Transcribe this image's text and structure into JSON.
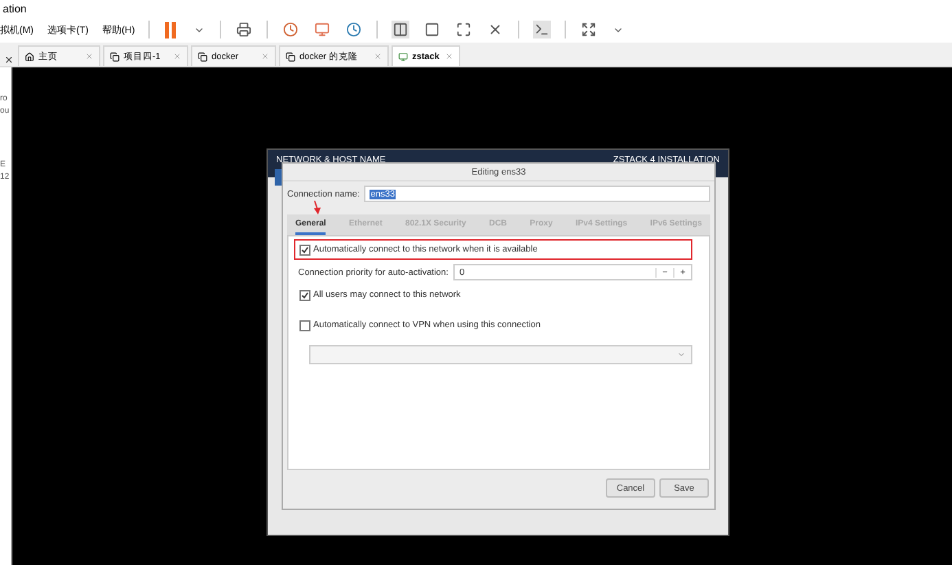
{
  "window": {
    "title": "ation"
  },
  "menu": [
    "拟机(M)",
    "选项卡(T)",
    "帮助(H)"
  ],
  "tabs": [
    {
      "label": "主页",
      "selected": false
    },
    {
      "label": "项目四-1",
      "selected": false
    },
    {
      "label": "docker",
      "selected": false
    },
    {
      "label": "docker 的克隆",
      "selected": false
    },
    {
      "label": "zstack",
      "selected": true
    }
  ],
  "sidebar": {
    "fragments": [
      "ro",
      "ou",
      "E",
      "12"
    ]
  },
  "installer": {
    "section": "NETWORK & HOST NAME",
    "product": "ZSTACK 4 INSTALLATION"
  },
  "dialog": {
    "title": "Editing ens33",
    "connection_name_label": "Connection name:",
    "connection_name": "ens33",
    "tabs": [
      {
        "label": "General",
        "selected": true
      },
      {
        "label": "Ethernet",
        "selected": false
      },
      {
        "label": "802.1X Security",
        "selected": false
      },
      {
        "label": "DCB",
        "selected": false
      },
      {
        "label": "Proxy",
        "selected": false
      },
      {
        "label": "IPv4 Settings",
        "selected": false
      },
      {
        "label": "IPv6 Settings",
        "selected": false
      }
    ],
    "auto_connect": {
      "label": "Automatically connect to this network when it is available",
      "checked": true,
      "highlighted": true
    },
    "priority": {
      "label": "Connection priority for auto-activation:",
      "value": "0",
      "minus": "−",
      "plus": "+"
    },
    "all_users": {
      "label": "All users may connect to this network",
      "checked": true
    },
    "vpn": {
      "label": "Automatically connect to VPN when using this connection",
      "checked": false
    },
    "buttons": [
      "Cancel",
      "Save"
    ]
  }
}
